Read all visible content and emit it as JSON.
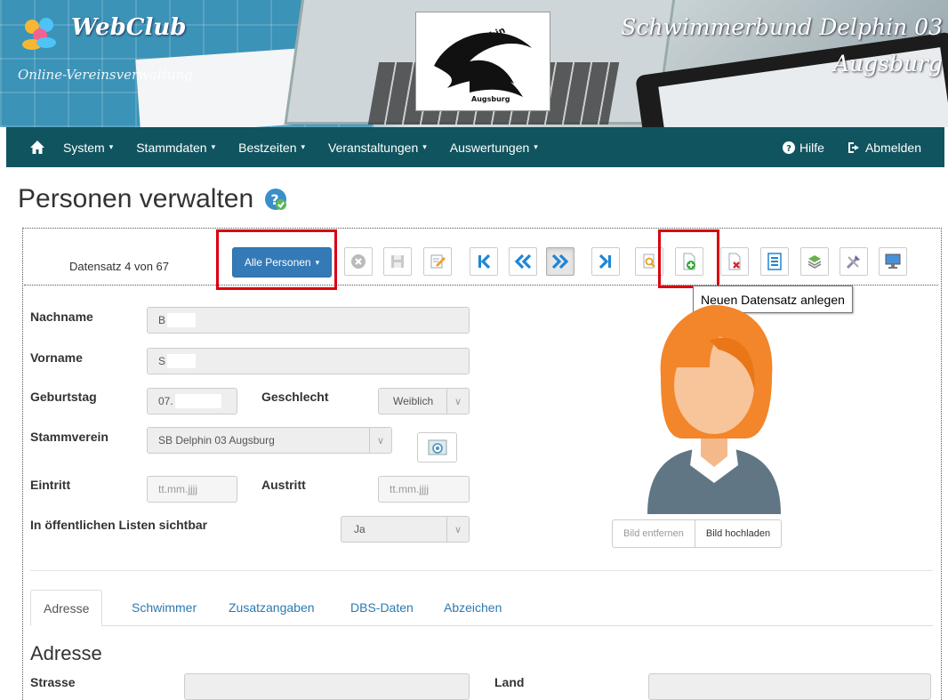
{
  "banner": {
    "app_name": "WebClub",
    "app_subtitle": "Online-Vereinsverwaltung",
    "club_line1": "Schwimmerbund Delphin 03",
    "club_line2": "Augsburg",
    "logo_top": "SB Delphin",
    "logo_bottom": "Augsburg"
  },
  "nav": {
    "items": [
      "System",
      "Stammdaten",
      "Bestzeiten",
      "Veranstaltungen",
      "Auswertungen"
    ],
    "help": "Hilfe",
    "logout": "Abmelden"
  },
  "page": {
    "title": "Personen verwalten"
  },
  "toolbar": {
    "record_info": "Datensatz 4 von 67",
    "all_persons": "Alle Personen",
    "tooltip": "Neuen Datensatz anlegen"
  },
  "form": {
    "nachname_label": "Nachname",
    "nachname_value": "B",
    "vorname_label": "Vorname",
    "vorname_value": "S",
    "geburtstag_label": "Geburtstag",
    "geburtstag_value": "07.",
    "geschlecht_label": "Geschlecht",
    "geschlecht_value": "Weiblich",
    "stammverein_label": "Stammverein",
    "stammverein_value": "SB Delphin 03 Augsburg",
    "eintritt_label": "Eintritt",
    "eintritt_placeholder": "tt.mm.jjjj",
    "austritt_label": "Austritt",
    "austritt_placeholder": "tt.mm.jjjj",
    "public_label": "In öffentlichen Listen sichtbar",
    "public_value": "Ja"
  },
  "photo": {
    "remove": "Bild entfernen",
    "upload": "Bild hochladen"
  },
  "tabs": [
    "Adresse",
    "Schwimmer",
    "Zusatzangaben",
    "DBS-Daten",
    "Abzeichen"
  ],
  "address": {
    "title": "Adresse",
    "strasse_label": "Strasse",
    "land_label": "Land"
  },
  "colors": {
    "navbar": "#10545f",
    "primary": "#337ab7",
    "highlight": "#d9000f",
    "link": "#2a7ab0"
  }
}
